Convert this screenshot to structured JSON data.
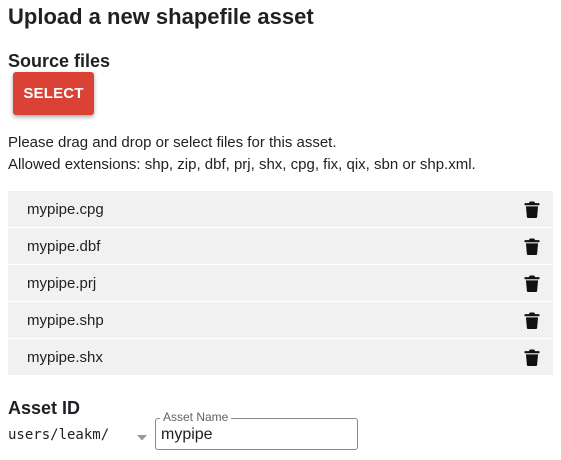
{
  "page": {
    "title": "Upload a new shapefile asset"
  },
  "source_files": {
    "heading": "Source files",
    "select_label": "SELECT",
    "help_line1": "Please drag and drop or select files for this asset.",
    "help_line2": "Allowed extensions: shp, zip, dbf, prj, shx, cpg, fix, qix, sbn or shp.xml.",
    "files": [
      {
        "name": "mypipe.cpg",
        "action_icon": "delete-icon"
      },
      {
        "name": "mypipe.dbf",
        "action_icon": "delete-icon"
      },
      {
        "name": "mypipe.prj",
        "action_icon": "delete-icon"
      },
      {
        "name": "mypipe.shp",
        "action_icon": "delete-icon"
      },
      {
        "name": "mypipe.shx",
        "action_icon": "delete-icon"
      }
    ]
  },
  "asset_id": {
    "heading": "Asset ID",
    "prefix": "users/leakm/",
    "name_label": "Asset Name",
    "name_value": "mypipe"
  },
  "colors": {
    "select_button": "#d94235",
    "file_row_bg": "#f1f1f1"
  }
}
